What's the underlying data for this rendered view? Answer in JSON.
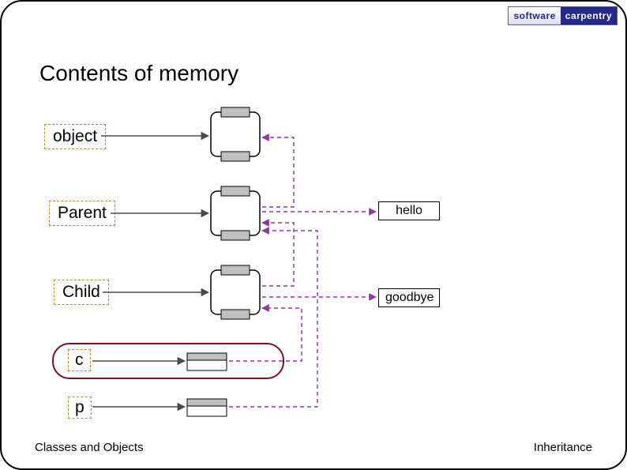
{
  "logo": {
    "left": "software",
    "right": "carpentry"
  },
  "title": "Contents of memory",
  "labels": {
    "object": "object",
    "parent": "Parent",
    "child": "Child",
    "c": "c",
    "p": "p"
  },
  "methods": {
    "hello": "hello",
    "goodbye": "goodbye"
  },
  "footer": {
    "left": "Classes and Objects",
    "right": "Inheritance"
  },
  "colors": {
    "dashed": "#8a3aa0",
    "solid_arrow": "#4a4a4a",
    "fill_gray": "#bfbfbf",
    "dash_gold": "#b38f3f"
  }
}
